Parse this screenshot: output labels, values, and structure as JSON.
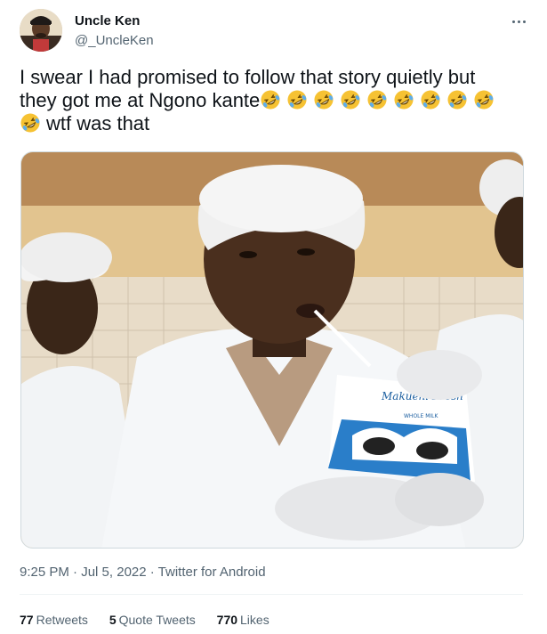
{
  "author": {
    "display_name": "Uncle Ken",
    "handle": "@_UncleKen"
  },
  "more_icon": "more-horizontal-icon",
  "tweet": {
    "text_line_1": "I swear I had promised to follow that story quietly but",
    "text_line_2_prefix": "they got me at Ngono kante",
    "text_line_3_suffix": "wtf was that",
    "emoji": "rolling-on-floor-laughing",
    "emoji_count": 10
  },
  "media": {
    "carton_brand": "Makueni Fresh",
    "carton_label": "WHOLE MILK"
  },
  "meta": {
    "time": "9:25 PM",
    "separator_1": " · ",
    "date": "Jul 5, 2022",
    "separator_2": " · ",
    "source": "Twitter for Android"
  },
  "stats": {
    "retweets_count": "77",
    "retweets_label": "Retweets",
    "quotes_count": "5",
    "quotes_label": "Quote Tweets",
    "likes_count": "770",
    "likes_label": "Likes"
  },
  "colors": {
    "text_primary": "#0f1419",
    "text_secondary": "#536471",
    "divider": "#eff3f4",
    "emoji_face": "#f6c233"
  }
}
